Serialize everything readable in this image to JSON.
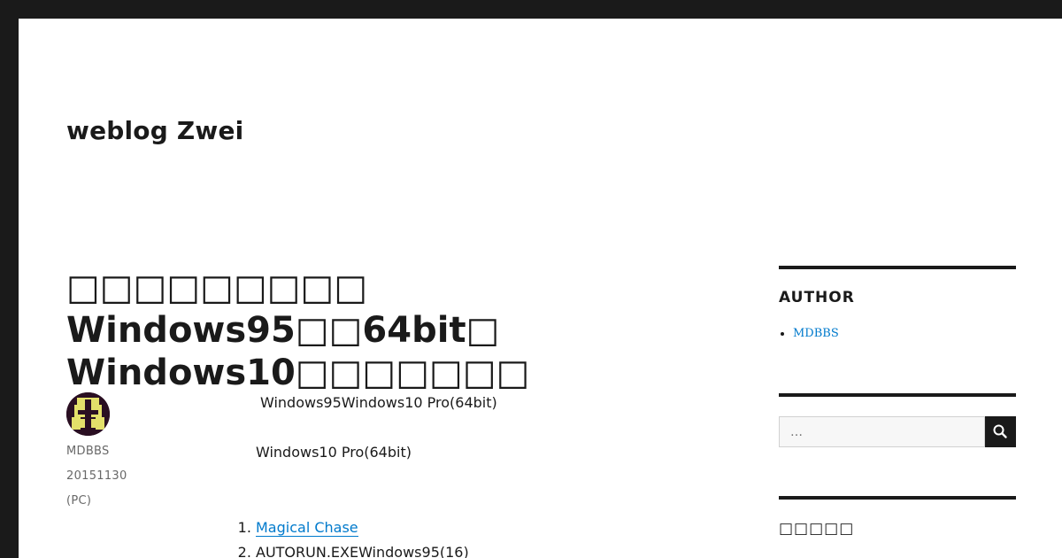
{
  "site": {
    "title": "weblog Zwei"
  },
  "post": {
    "title": "□□□□□□□□□ Windows95□□64bit□ Windows10□□□□□□□",
    "author": "MDBBS",
    "date": "20151130",
    "category": "(PC)",
    "paragraph1": "Windows95Windows10 Pro(64bit)",
    "paragraph2": "Windows10 Pro(64bit)",
    "list": [
      {
        "label": "Magical Chase",
        "is_link": true
      },
      {
        "label": "AUTORUN.EXEWindows95(16)",
        "is_link": false
      }
    ]
  },
  "sidebar": {
    "author_widget": {
      "title": "AUTHOR",
      "items": [
        "MDBBS"
      ]
    },
    "search": {
      "placeholder": "…"
    },
    "third_widget": {
      "title": "□□□□□"
    }
  },
  "colors": {
    "frame": "#1a1a1a",
    "link": "#007acc",
    "meta_text": "#686868"
  },
  "icons": {
    "search": "magnifier-icon"
  }
}
